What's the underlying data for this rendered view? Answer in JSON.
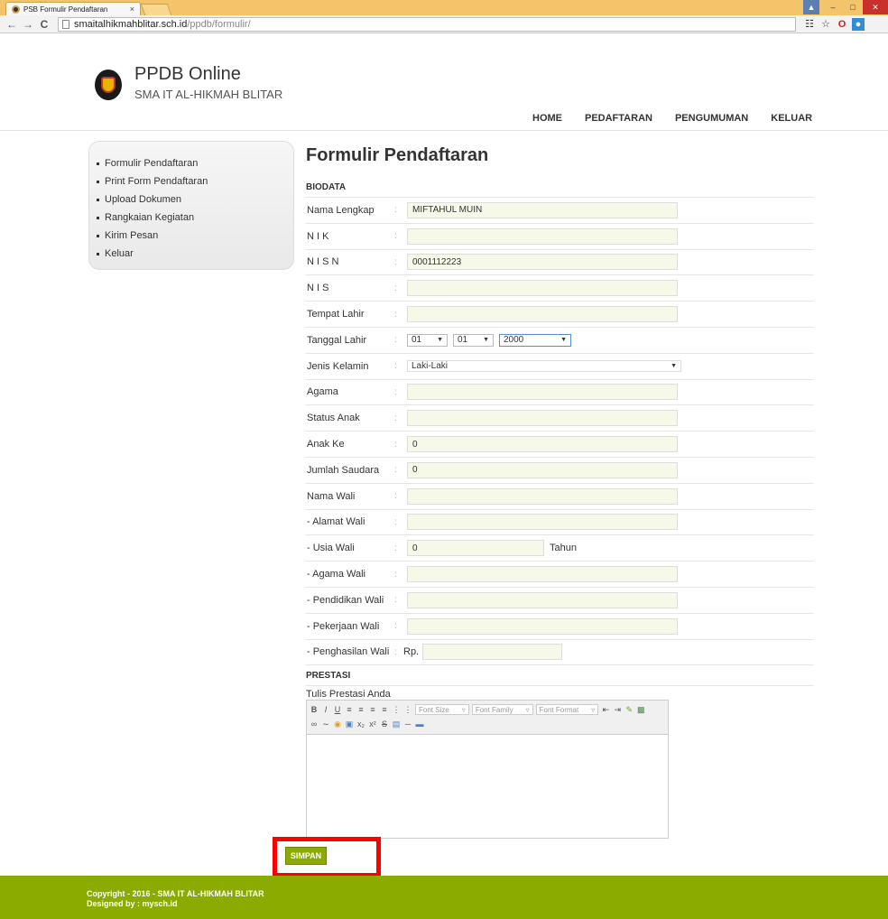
{
  "browser": {
    "tab_title": "PSB Formulir Pendaftaran",
    "tab_close": "×",
    "url_host": "smaitalhikmahblitar.sch.id",
    "url_path": "/ppdb/formulir/",
    "back": "←",
    "forward": "→",
    "reload": "C"
  },
  "header": {
    "title": "PPDB Online",
    "subtitle": "SMA IT AL-HIKMAH BLITAR",
    "nav": [
      "HOME",
      "PEDAFTARAN",
      "PENGUMUMAN",
      "KELUAR"
    ]
  },
  "sidebar": {
    "items": [
      "Formulir Pendaftaran",
      "Print Form Pendaftaran",
      "Upload Dokumen",
      "Rangkaian Kegiatan",
      "Kirim Pesan",
      "Keluar"
    ]
  },
  "form": {
    "title": "Formulir Pendaftaran",
    "section_biodata": "BIODATA",
    "colon": ":",
    "fields": {
      "nama_lengkap": {
        "label": "Nama Lengkap",
        "value": "MIFTAHUL MUIN"
      },
      "nik": {
        "label": "N I K",
        "value": ""
      },
      "nisn": {
        "label": "N I S N",
        "value": "0001112223"
      },
      "nis": {
        "label": "N I S",
        "value": ""
      },
      "tempat_lahir": {
        "label": "Tempat Lahir",
        "value": ""
      },
      "tanggal_lahir": {
        "label": "Tanggal Lahir",
        "day": "01",
        "month": "01",
        "year": "2000"
      },
      "jenis_kelamin": {
        "label": "Jenis Kelamin",
        "value": "Laki-Laki"
      },
      "agama": {
        "label": "Agama",
        "value": ""
      },
      "status_anak": {
        "label": "Status Anak",
        "value": ""
      },
      "anak_ke": {
        "label": "Anak Ke",
        "value": "0"
      },
      "jumlah_saudara": {
        "label": "Jumlah Saudara",
        "value": "0"
      },
      "nama_wali": {
        "label": "Nama Wali",
        "value": ""
      },
      "alamat_wali": {
        "label": "- Alamat Wali",
        "value": ""
      },
      "usia_wali": {
        "label": "- Usia Wali",
        "value": "0",
        "suffix": "Tahun"
      },
      "agama_wali": {
        "label": "- Agama Wali",
        "value": ""
      },
      "pendidikan_wali": {
        "label": "- Pendidikan Wali",
        "value": ""
      },
      "pekerjaan_wali": {
        "label": "- Pekerjaan Wali",
        "value": ""
      },
      "penghasilan_wali": {
        "label": "- Penghasilan Wali",
        "prefix": "Rp.",
        "value": ""
      }
    },
    "section_prestasi": "PRESTASI",
    "prestasi_label": "Tulis Prestasi Anda",
    "editor": {
      "font_size": "Font Size",
      "font_family": "Font Family",
      "font_format": "Font Format"
    },
    "save_label": "SIMPAN"
  },
  "footer": {
    "copyright": "Copyright - 2016 - SMA IT AL-HIKMAH BLITAR",
    "designed": "Designed by : mysch.id"
  }
}
